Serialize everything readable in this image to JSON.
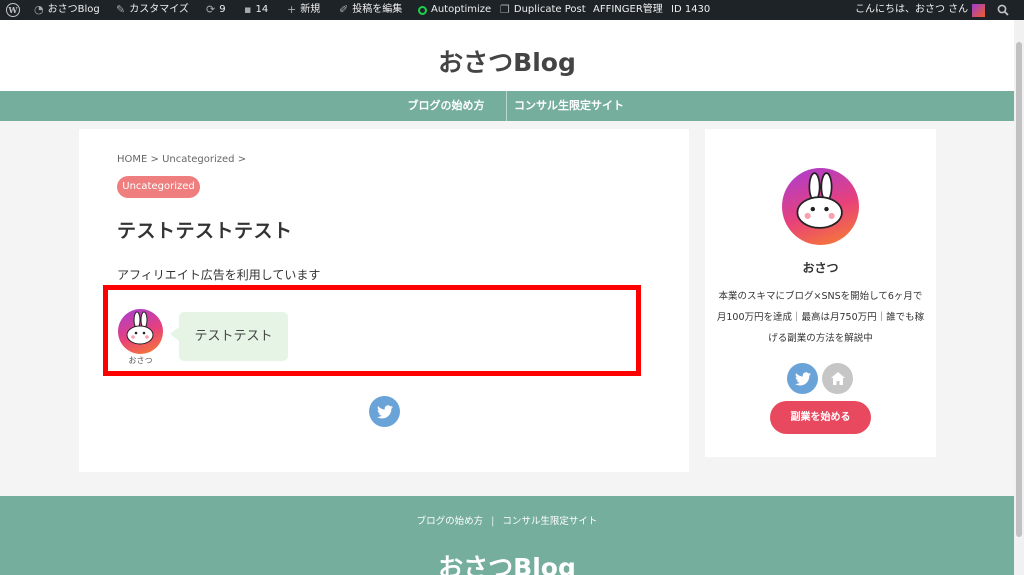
{
  "admin_bar": {
    "site": "おさつBlog",
    "customize": "カスタマイズ",
    "updates": "9",
    "comments": "14",
    "new": "新規",
    "edit_post": "投稿を編集",
    "autoptimize": "Autoptimize",
    "duplicate": "Duplicate Post",
    "affinger": "AFFINGER管理",
    "post_id": "ID 1430",
    "greeting": "こんにちは、おさつ さん"
  },
  "header": {
    "site_title": "おさつBlog",
    "nav": [
      "ブログの始め方",
      "コンサル生限定サイト"
    ]
  },
  "article": {
    "breadcrumb": "HOME > Uncategorized >",
    "category": "Uncategorized",
    "title": "テストテストテスト",
    "affiliate_notice": "アフィリエイト広告を利用しています",
    "speaker_name": "おさつ",
    "bubble_text": "テストテスト"
  },
  "sidebar": {
    "name": "おさつ",
    "description": "本業のスキマにブログ×SNSを開始して6ヶ月で月100万円を達成｜最高は月750万円｜誰でも稼げる副業の方法を解説中",
    "cta": "副業を始める"
  },
  "footer": {
    "nav": [
      "ブログの始め方",
      "コンサル生限定サイト"
    ],
    "site_title": "おさつBlog"
  },
  "colors": {
    "nav_bg": "#75ae9c",
    "category_badge": "#ee7f7e",
    "cta_button": "#e8495e",
    "twitter": "#6aa3d8",
    "highlight_border": "#ff0000",
    "bubble_bg": "#e5f4e5"
  }
}
